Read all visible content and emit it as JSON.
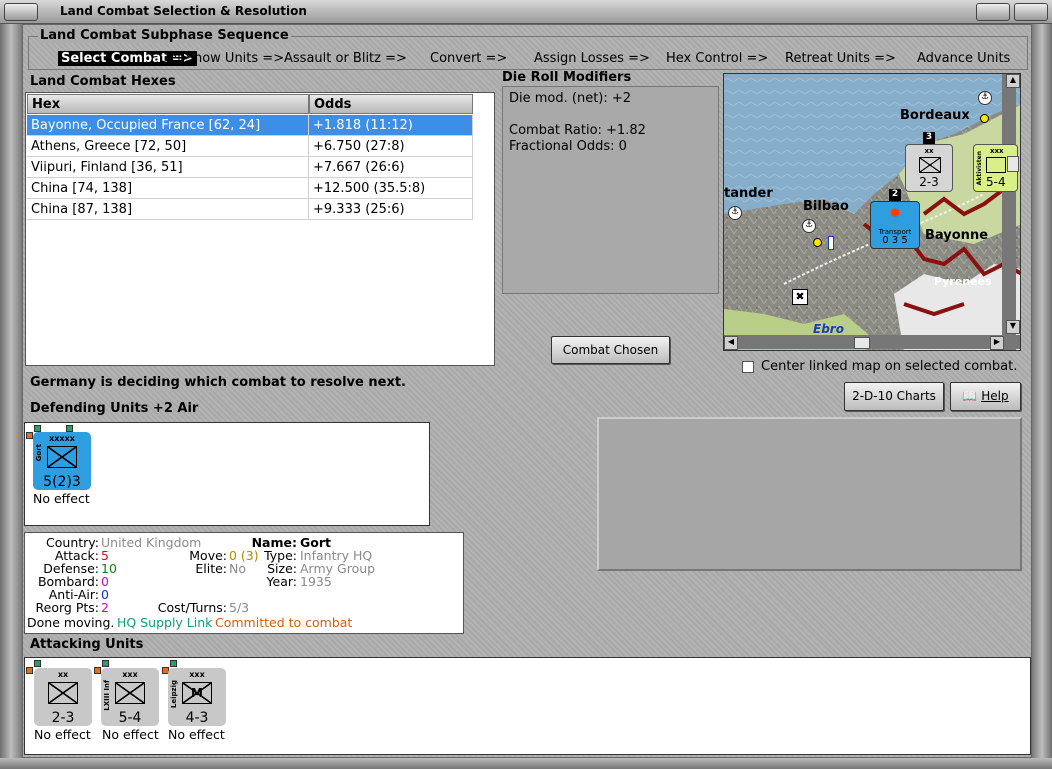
{
  "window": {
    "title": "Land Combat Selection & Resolution"
  },
  "sequence": {
    "title": "Land Combat Subphase Sequence",
    "steps": [
      "Select Combat =>",
      "Def Snow Units =>",
      "Assault or Blitz =>",
      "Convert =>",
      "Assign Losses =>",
      "Hex Control =>",
      "Retreat Units =>",
      "Advance Units"
    ],
    "active_index": 0
  },
  "hexes": {
    "title": "Land Combat Hexes",
    "columns": [
      "Hex",
      "Odds"
    ],
    "rows": [
      {
        "hex": "Bayonne, Occupied France [62, 24]",
        "odds": "+1.818 (11:12)",
        "selected": true
      },
      {
        "hex": "Athens, Greece [72, 50]",
        "odds": "+6.750 (27:8)"
      },
      {
        "hex": "Viipuri, Finland [36, 51]",
        "odds": "+7.667 (26:6)"
      },
      {
        "hex": "China [74, 138]",
        "odds": "+12.500 (35.5:8)"
      },
      {
        "hex": "China [87, 138]",
        "odds": "+9.333 (25:6)"
      }
    ]
  },
  "die_roll": {
    "title": "Die Roll Modifiers",
    "line1": "Die mod. (net): +2",
    "line2": "Combat Ratio: +1.82",
    "line3": "Fractional Odds: 0"
  },
  "buttons": {
    "combat_chosen": "Combat Chosen",
    "charts": "2-D-10 Charts",
    "help": "Help"
  },
  "map": {
    "labels": [
      "Bordeaux",
      "tander",
      "Bilbao",
      "Bayonne",
      "Pyrenees",
      "Ebro",
      "Transport"
    ],
    "link_checkbox": "Center linked map on selected combat.",
    "link_checked": false,
    "units": [
      {
        "size": "xx",
        "values": "2-3",
        "stack": "3"
      },
      {
        "size": "xxx",
        "values": "5-4",
        "name": "Aktivisten"
      },
      {
        "values": "0 3 5",
        "stack": "2"
      }
    ]
  },
  "status": "Germany is deciding which combat to resolve next.",
  "defending": {
    "title": "Defending Units +2 Air",
    "units": [
      {
        "name": "Gort",
        "size": "xxxxx",
        "values": "5(2)3",
        "result": "No effect",
        "color": "#2f9ee0"
      }
    ]
  },
  "info": {
    "country_label": "Country:",
    "country": "United Kingdom",
    "attack_label": "Attack:",
    "attack": "5",
    "defense_label": "Defense:",
    "defense": "10",
    "bombard_label": "Bombard:",
    "bombard": "0",
    "antiair_label": "Anti-Air:",
    "antiair": "0",
    "reorg_label": "Reorg Pts:",
    "reorg": "2",
    "move_label": "Move:",
    "move": "0 (3)",
    "elite_label": "Elite:",
    "elite": "No",
    "cost_label": "Cost/Turns:",
    "cost": "5/3",
    "name_label": "Name:",
    "name": "Gort",
    "type_label": "Type:",
    "type": "Infantry HQ",
    "size_label": "Size:",
    "size": "Army Group",
    "year_label": "Year:",
    "year": "1935",
    "done": "Done moving.",
    "supply": "HQ Supply Link",
    "committed": "Committed to combat"
  },
  "attacking": {
    "title": "Attacking Units",
    "units": [
      {
        "name": "",
        "size": "xx",
        "values": "2-3",
        "result": "No effect",
        "symbol": "X"
      },
      {
        "name": "LXIII Inf",
        "size": "xxx",
        "values": "5-4",
        "result": "No effect",
        "symbol": "X"
      },
      {
        "name": "Leipzig",
        "size": "xxx",
        "values": "4-3",
        "result": "No effect",
        "symbol": "M"
      }
    ]
  }
}
